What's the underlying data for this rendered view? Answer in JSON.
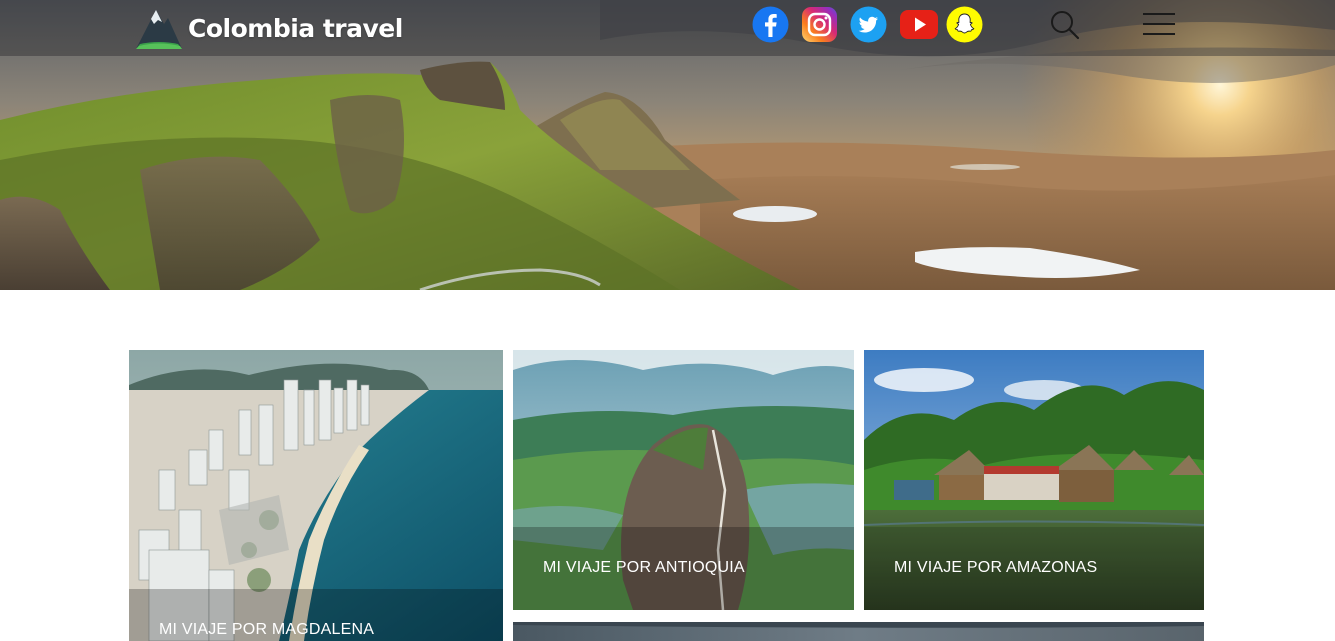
{
  "brand": {
    "title": "Colombia travel",
    "logo_icon": "mountain-logo-icon"
  },
  "social": [
    {
      "name": "facebook-icon",
      "color": "#1877f2"
    },
    {
      "name": "instagram-icon",
      "color": "#c13584"
    },
    {
      "name": "twitter-icon",
      "color": "#1da1f2"
    },
    {
      "name": "youtube-icon",
      "color": "#e62117"
    },
    {
      "name": "snapchat-icon",
      "color": "#fffc00"
    }
  ],
  "nav": {
    "search_icon": "search-icon",
    "menu_icon": "hamburger-menu-icon"
  },
  "cards": [
    {
      "label": "MI VIAJE POR MAGDALENA"
    },
    {
      "label": "MI VIAJE POR ANTIOQUIA"
    },
    {
      "label": "MI VIAJE POR AMAZONAS"
    },
    {
      "label": ""
    }
  ]
}
